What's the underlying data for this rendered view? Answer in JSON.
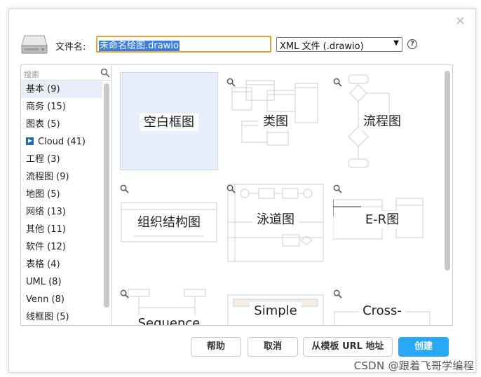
{
  "dialog": {
    "close_icon": "×",
    "filename_label": "文件名:",
    "filename_value": "未命名绘图.drawio",
    "format_value": "XML 文件 (.drawio)",
    "help_glyph": "?"
  },
  "sidebar": {
    "search_placeholder": "搜索",
    "categories": [
      "基本 (9)",
      "商务 (15)",
      "图表 (5)",
      "Cloud (41)",
      "工程 (3)",
      "流程图 (9)",
      "地图 (5)",
      "网络 (13)",
      "其他 (11)",
      "软件 (12)",
      "表格 (4)",
      "UML (8)",
      "Venn (8)",
      "线框图 (5)"
    ]
  },
  "templates": {
    "tiles": [
      "空白框图",
      "类图",
      "流程图",
      "组织结构图",
      "泳道图",
      "E-R图",
      "Sequence",
      "Simple",
      "Cross-"
    ]
  },
  "buttons": {
    "help": "帮助",
    "cancel": "取消",
    "from_url": "从模板 URL 地址",
    "create": "创建"
  },
  "watermark": "CSDN @跟着飞哥学编程",
  "colors": {
    "accent": "#29a8f5",
    "input_border": "#e5a336",
    "selection": "#3d7fe0",
    "selected_tile": "#e7eef9"
  }
}
